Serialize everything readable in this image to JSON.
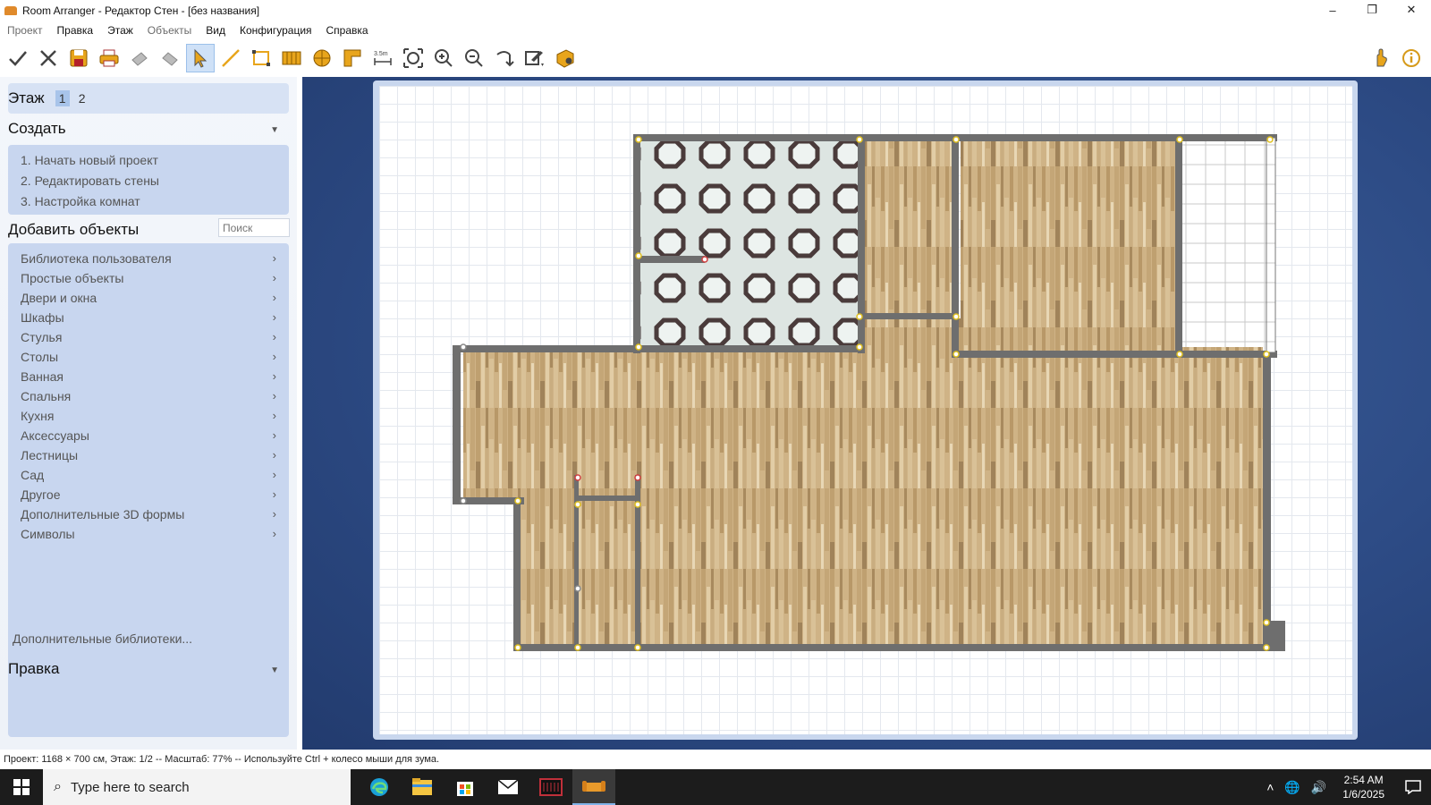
{
  "titlebar": {
    "title": "Room Arranger - Редактор Стен - [без названия]",
    "minimize": "–",
    "restore": "❐",
    "close": "✕"
  },
  "menu": [
    "Проект",
    "Правка",
    "Этаж",
    "Объекты",
    "Вид",
    "Конфигурация",
    "Справка"
  ],
  "toolbar": {
    "scale_label": "3.5m",
    "tools": [
      "check-icon",
      "cancel-icon",
      "save-icon",
      "print-icon",
      "undo-icon",
      "redo-icon",
      "select-arrow-icon",
      "wall-line-icon",
      "rectangle-room-icon",
      "wall-segments-icon",
      "circular-room-icon",
      "floor-area-icon",
      "dimension-icon",
      "zoom-fit-icon",
      "zoom-in-icon",
      "zoom-out-icon",
      "rotate-view-icon",
      "edit-dropdown-icon",
      "3d-view-icon",
      "hand-icon",
      "info-icon"
    ]
  },
  "left_panel": {
    "floor": {
      "label": "Этаж",
      "tabs": [
        "1",
        "2"
      ]
    },
    "create": {
      "header": "Создать",
      "steps": [
        "1. Начать новый проект",
        "2. Редактировать стены",
        "3. Настройка комнат"
      ]
    },
    "add_objects": {
      "header": "Добавить объекты",
      "search_placeholder": "Поиск",
      "categories": [
        "Библиотека пользователя",
        "Простые объекты",
        "Двери и окна",
        "Шкафы",
        "Стулья",
        "Столы",
        "Ванная",
        "Спальня",
        "Кухня",
        "Аксессуары",
        "Лестницы",
        "Сад",
        "Другое",
        "Дополнительные 3D формы",
        "Символы"
      ],
      "more_libraries": "Дополнительные библиотеки..."
    },
    "edit": {
      "header": "Правка"
    }
  },
  "status": {
    "text": "Проект: 1168 × 700 см, Этаж: 1/2 -- Масштаб: 77% -- Используйте Ctrl + колесо мыши для зума."
  },
  "taskbar": {
    "search_text": "Type here to search",
    "time": "2:54 AM",
    "date": "1/6/2025"
  },
  "colors": {
    "accent": "#2d4b85",
    "panel_blue": "#c8d6ef",
    "wall": "#6e6e6e",
    "wood": "#c9a978",
    "tile": "#dfe6e3"
  }
}
